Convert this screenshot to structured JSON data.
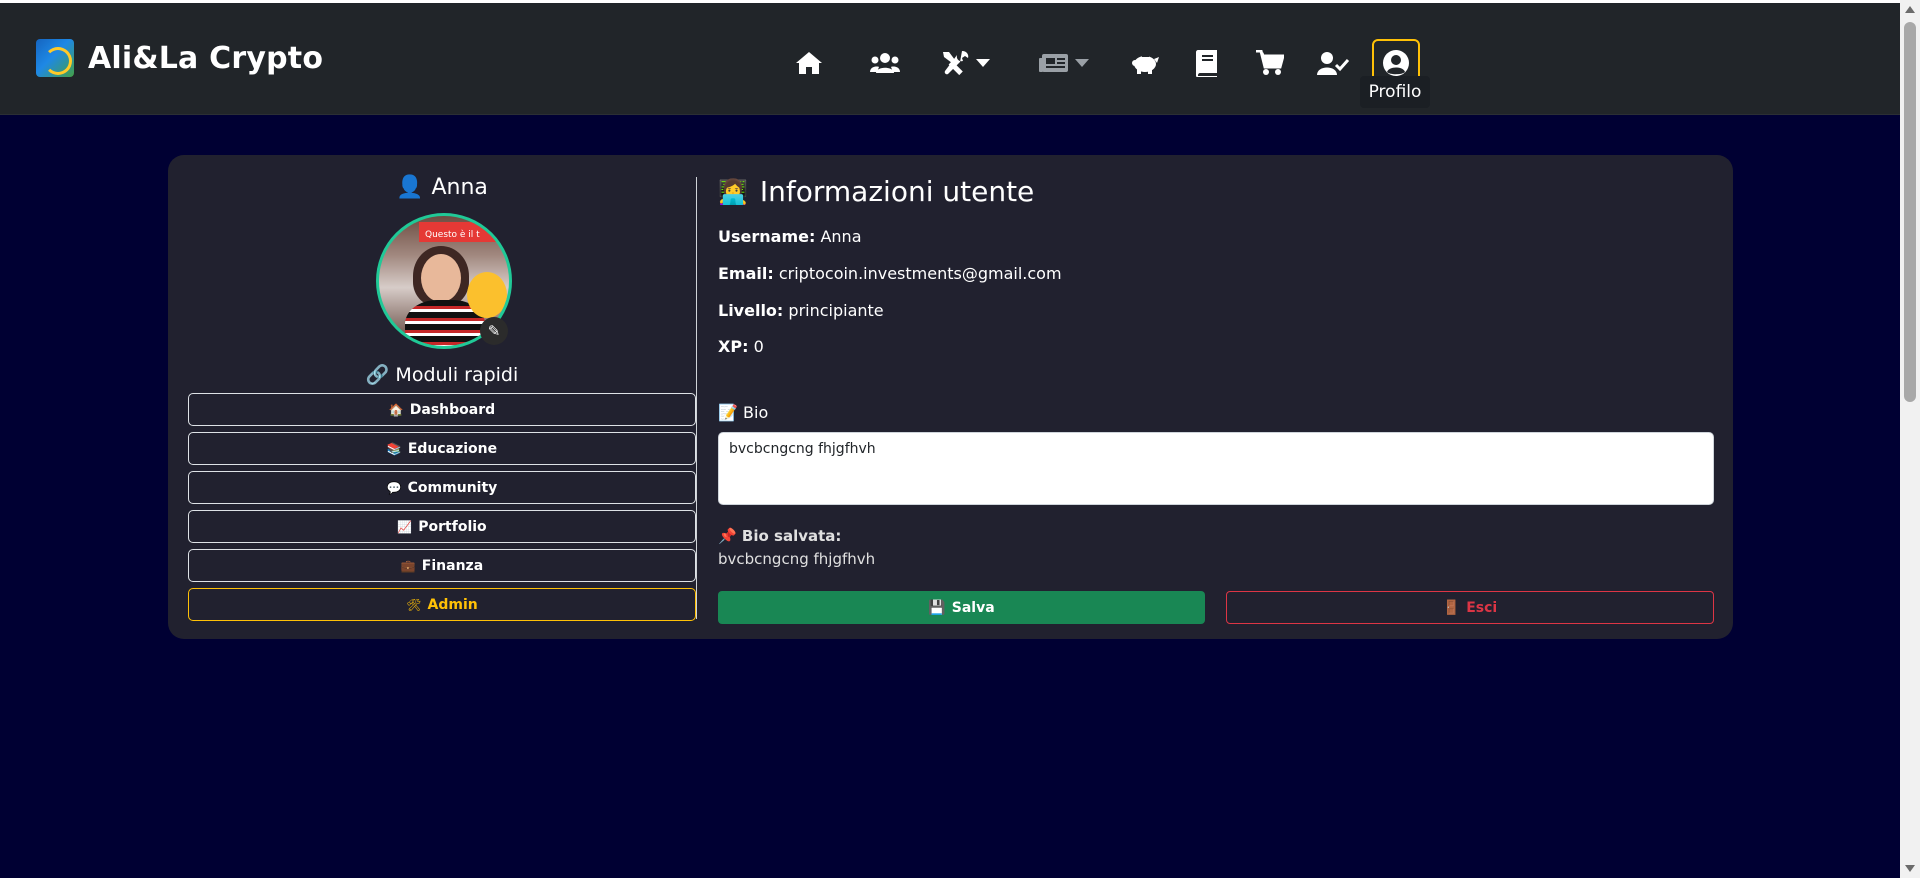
{
  "brand": {
    "name": "Ali&La Crypto",
    "logo_icon": "globe-logo-icon"
  },
  "nav": {
    "icons": [
      "home-icon",
      "users-icon",
      "tools-icon",
      "news-icon",
      "piggy-bank-icon",
      "book-icon",
      "cart-icon",
      "user-check-icon",
      "user-circle-icon"
    ],
    "tooltip": "Profilo",
    "active_color": "#ffc107"
  },
  "profile": {
    "user_icon": "👤",
    "name": "Anna",
    "avatar_banner": "Questo è il t",
    "edit_icon": "✎",
    "quick_title_icon": "🔗",
    "quick_title": "Moduli rapidi",
    "quick_links": [
      {
        "emoji": "🏠",
        "label": "Dashboard"
      },
      {
        "emoji": "📚",
        "label": "Educazione"
      },
      {
        "emoji": "💬",
        "label": "Community"
      },
      {
        "emoji": "📈",
        "label": "Portfolio"
      },
      {
        "emoji": "💼",
        "label": "Finanza"
      }
    ],
    "admin_link": {
      "emoji": "🛠",
      "label": "Admin"
    }
  },
  "info": {
    "title_icon": "👩‍💻",
    "title": "Informazioni utente",
    "username_label": "Username:",
    "username": "Anna",
    "email_label": "Email:",
    "email": "criptocoin.investments@gmail.com",
    "level_label": "Livello:",
    "level": "principiante",
    "xp_label": "XP:",
    "xp": "0",
    "bio_icon": "📝",
    "bio_label": "Bio",
    "bio_value": "bvcbcngcng fhjgfhvh",
    "saved_icon": "📌",
    "saved_label": "Bio salvata:",
    "saved_value": "bvcbcngcng fhjgfhvh",
    "save_icon": "💾",
    "save_label": "Salva",
    "exit_icon": "🚪",
    "exit_label": "Esci"
  },
  "colors": {
    "background": "#000033",
    "navbar": "#212529",
    "card": "#21212f",
    "save": "#198754",
    "exit": "#dc3545",
    "admin": "#ffc107",
    "avatar_border": "#20c997"
  }
}
